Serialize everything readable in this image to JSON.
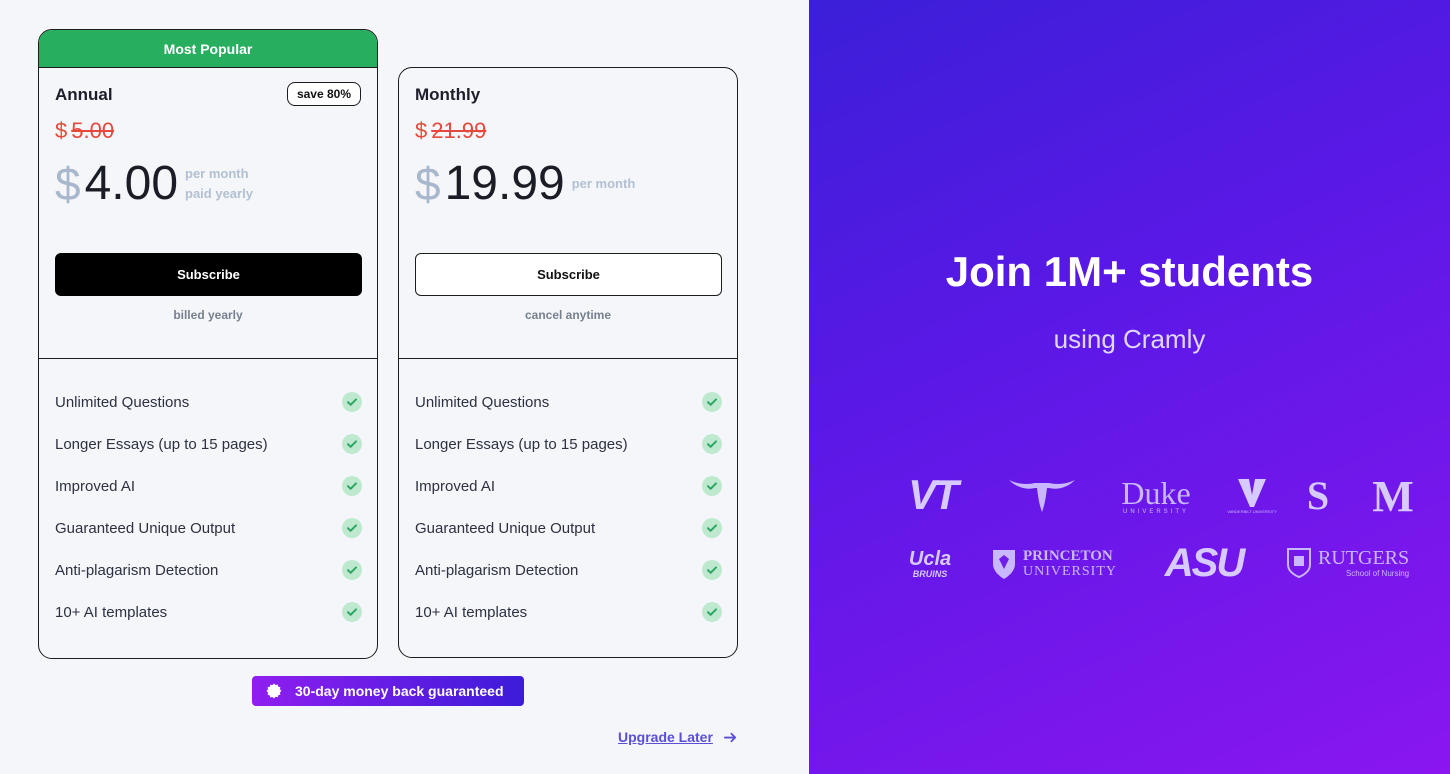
{
  "annual": {
    "badge": "Most Popular",
    "name": "Annual",
    "save": "save 80%",
    "currency": "$",
    "old_price": "5.00",
    "price": "4.00",
    "per_line1": "per month",
    "per_line2": "paid yearly",
    "button": "Subscribe",
    "note": "billed yearly"
  },
  "monthly": {
    "name": "Monthly",
    "currency": "$",
    "old_price": "21.99",
    "price": "19.99",
    "per_line1": "per month",
    "button": "Subscribe",
    "note": "cancel anytime"
  },
  "features": [
    "Unlimited Questions",
    "Longer Essays (up to 15 pages)",
    "Improved AI",
    "Guaranteed Unique Output",
    "Anti-plagarism Detection",
    "10+ AI templates"
  ],
  "guarantee": "30-day money back guaranteed",
  "upgrade_later": "Upgrade Later",
  "promo": {
    "title": "Join 1M+ students",
    "subtitle": "using Cramly"
  },
  "logos": {
    "vt": "VT",
    "duke": "Duke",
    "duke_sub": "UNIVERSITY",
    "vanderbilt_sub": "VANDERBILT UNIVERSITY",
    "stanford": "S",
    "michigan": "M",
    "ucla": "Ucla",
    "ucla_sub": "BRUINS",
    "princeton_1": "PRINCETON",
    "princeton_2": "UNIVERSITY",
    "asu": "ASU",
    "rutgers": "RUTGERS",
    "rutgers_sub": "School of Nursing"
  },
  "colors": {
    "popular_green": "#28ae5f",
    "strike_red": "#e5483c",
    "check_bg": "#bfe9cf",
    "check_fg": "#2ea564",
    "gradient_start": "#3b1fd8",
    "gradient_end": "#8a16f0",
    "link_purple": "#5b4fd6"
  },
  "icons": {
    "feature": "check-circle-icon",
    "guarantee": "seal-badge-icon",
    "upgrade": "arrow-right-icon"
  }
}
